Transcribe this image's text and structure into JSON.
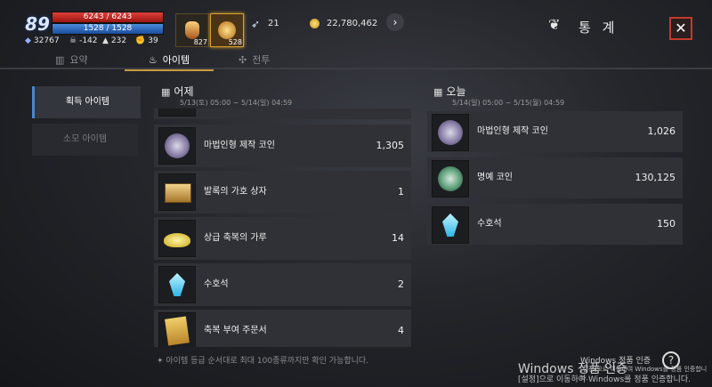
{
  "hud": {
    "level": "89",
    "hp": "6243 / 6243",
    "mp": "1528 / 1528",
    "stat1": "32767",
    "stat2": "-142",
    "stat3": "232",
    "stat4": "39",
    "slot1_count": "827",
    "slot2_count": "528",
    "feather_count": "21",
    "gold": "22,780,462"
  },
  "header": {
    "title": "통 계",
    "close": "✕"
  },
  "tabs": [
    {
      "label": "요약",
      "icon": "bar-chart-icon"
    },
    {
      "label": "아이템",
      "icon": "pouch-icon"
    },
    {
      "label": "전투",
      "icon": "combat-icon"
    }
  ],
  "sidebar": [
    {
      "label": "획득 아이템"
    },
    {
      "label": "소모 아이템"
    }
  ],
  "yesterday": {
    "title": "어제",
    "date_range": "5/13(토) 05:00 ~ 5/14(일) 04:59",
    "items": [
      {
        "name": "마법인형 제작 코인",
        "value": "1,305",
        "icon": "magic-doll-coin-icon"
      },
      {
        "name": "발록의 가호 상자",
        "value": "1",
        "icon": "chest-icon"
      },
      {
        "name": "상급 축복의 가루",
        "value": "14",
        "icon": "blessing-powder-icon"
      },
      {
        "name": "수호석",
        "value": "2",
        "icon": "guardian-stone-icon"
      },
      {
        "name": "축복 부여 주문서",
        "value": "4",
        "icon": "scroll-icon"
      }
    ]
  },
  "today": {
    "title": "오늘",
    "date_range": "5/14(일) 05:00 ~ 5/15(월) 04:59",
    "items": [
      {
        "name": "마법인형 제작 코인",
        "value": "1,026",
        "icon": "magic-doll-coin-icon"
      },
      {
        "name": "명예 코인",
        "value": "130,125",
        "icon": "honor-coin-icon"
      },
      {
        "name": "수호석",
        "value": "150",
        "icon": "guardian-stone-icon"
      }
    ]
  },
  "footnote": "✦ 아이템 등급 순서대로 최대 100종류까지만 확인 가능합니다.",
  "windows": {
    "overlay1": "Windows 정품 인증",
    "overlay2": "[설정]으로 이동하여 Windows를 정품 인증합니다.",
    "main": "Windows 정품 인증",
    "sub": "[설정]으로 이동하여 Windows를 정품 인증합니다."
  },
  "colors": {
    "hp": "#c42a22",
    "mp": "#2f6fc2",
    "accent_tab": "#c99a3e",
    "close_border": "#c23a2a"
  }
}
